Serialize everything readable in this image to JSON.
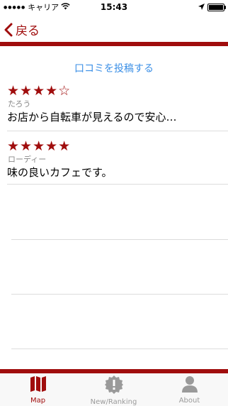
{
  "status_bar": {
    "carrier": "キャリア",
    "time": "15:43"
  },
  "nav": {
    "back_label": "戻る"
  },
  "post_review_label": "口コミを投稿する",
  "reviews": [
    {
      "rating": 4,
      "stars_text": "★★★★☆",
      "author": "たろう",
      "comment": "お店から自転車が見えるので安心…"
    },
    {
      "rating": 5,
      "stars_text": "★★★★★",
      "author": "ローディー",
      "comment": "味の良いカフェです。"
    }
  ],
  "tabs": [
    {
      "label": "Map",
      "icon": "map-icon",
      "active": true
    },
    {
      "label": "New/Ranking",
      "icon": "exclamation-badge-icon",
      "active": false
    },
    {
      "label": "About",
      "icon": "person-icon",
      "active": false
    }
  ],
  "colors": {
    "accent": "#a00d0d",
    "link": "#3b8fe6",
    "inactive": "#9a9a9a"
  }
}
